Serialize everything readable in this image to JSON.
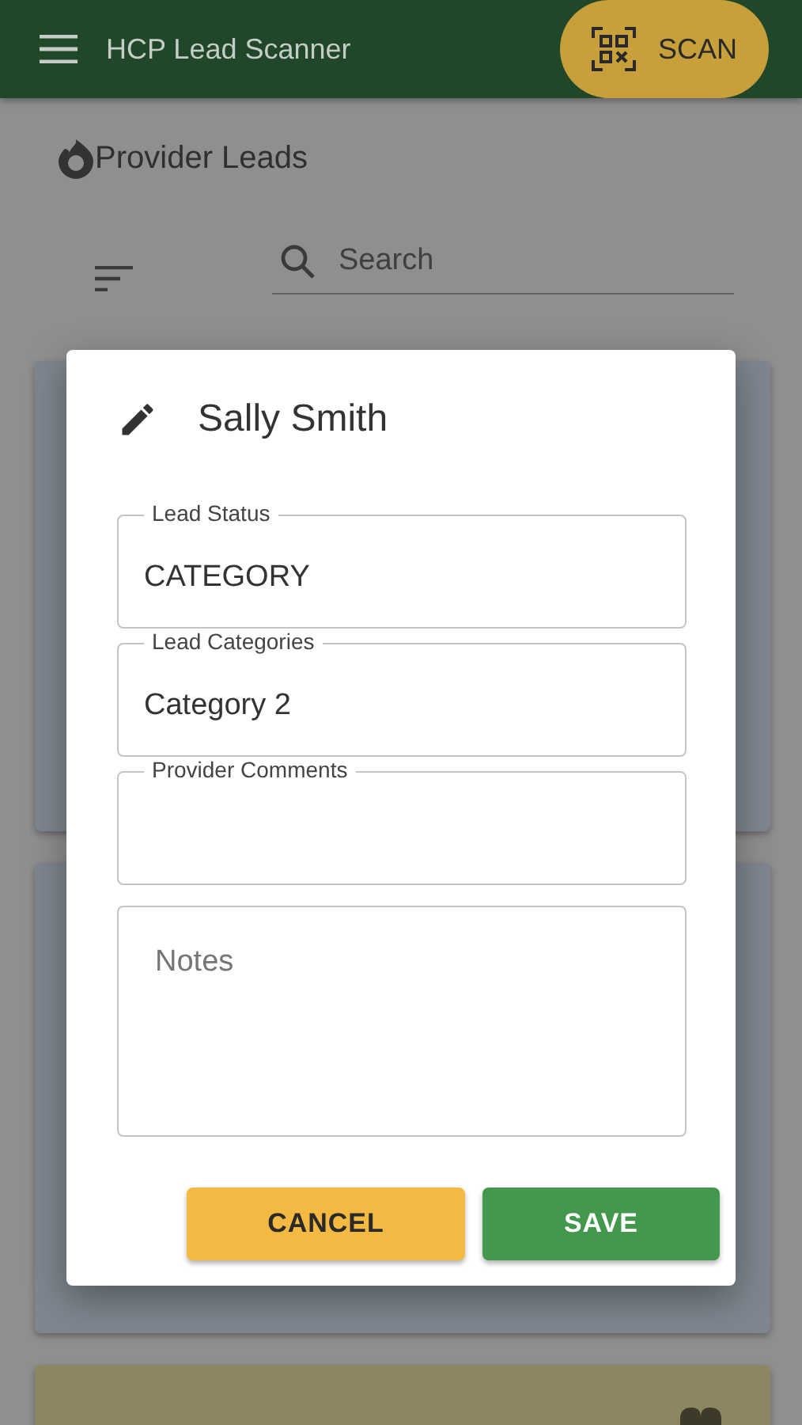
{
  "app_bar": {
    "title": "HCP Lead Scanner",
    "scan_button": "SCAN"
  },
  "page": {
    "title": "Provider Leads",
    "search": {
      "placeholder": "Search"
    }
  },
  "dialog": {
    "title": "Sally Smith",
    "fields": [
      {
        "label": "Lead Status",
        "value": "CATEGORY"
      },
      {
        "label": "Lead Categories",
        "value": "Category 2"
      },
      {
        "label": "Provider Comments"
      }
    ],
    "notes": {
      "placeholder": "Notes"
    },
    "buttons": [
      {
        "label": "CANCEL",
        "kind": "cancel"
      },
      {
        "label": "SAVE",
        "kind": "save"
      }
    ]
  }
}
